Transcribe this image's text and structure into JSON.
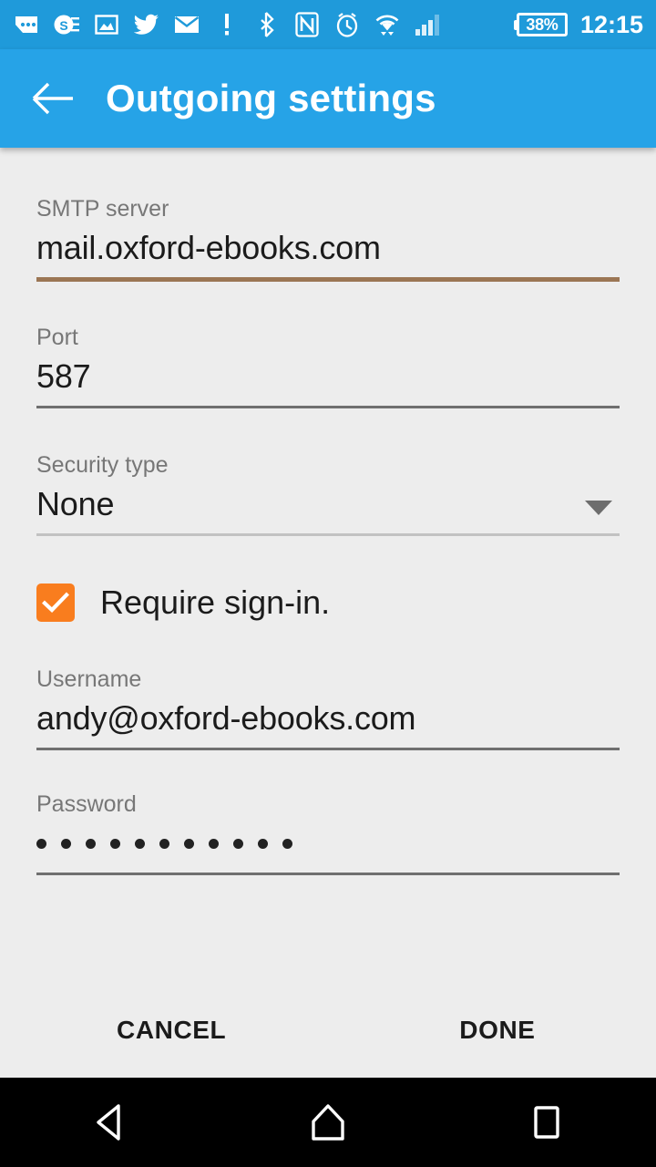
{
  "status_bar": {
    "background": "#1f9ada",
    "icons": [
      {
        "name": "messages-icon",
        "label": "messages"
      },
      {
        "name": "sway-document-icon",
        "label": "sway"
      },
      {
        "name": "photo-icon",
        "label": "photo"
      },
      {
        "name": "twitter-icon",
        "label": "twitter"
      },
      {
        "name": "email-icon",
        "label": "email"
      },
      {
        "name": "alert-exclamation-icon",
        "label": "alert"
      },
      {
        "name": "bluetooth-icon",
        "label": "bluetooth"
      },
      {
        "name": "nfc-icon",
        "label": "nfc"
      },
      {
        "name": "alarm-clock-icon",
        "label": "alarm"
      },
      {
        "name": "wifi-icon",
        "label": "wifi"
      },
      {
        "name": "cellular-signal-icon",
        "label": "signal"
      }
    ],
    "battery_level": "38%",
    "clock": "12:15"
  },
  "app_bar": {
    "background": "#26a3e7",
    "title": "Outgoing settings",
    "back_icon": "back-arrow-icon"
  },
  "form": {
    "smtp_server": {
      "label": "SMTP server",
      "value": "mail.oxford-ebooks.com",
      "underline_color": "#9b7654",
      "focused": true
    },
    "port": {
      "label": "Port",
      "value": "587",
      "underline_color": "#6f6f6f"
    },
    "security_type": {
      "label": "Security type",
      "value": "None",
      "underline_color": "#c2c2c2",
      "caret_icon": "chevron-down-icon"
    },
    "require_sign_in": {
      "label": "Require sign-in.",
      "checked": true,
      "checkbox_color": "#f97d1e"
    },
    "username": {
      "label": "Username",
      "value": "andy@oxford-ebooks.com",
      "underline_color": "#6f6f6f"
    },
    "password": {
      "label": "Password",
      "masked_value": "•••••••••••",
      "dot_count": 11,
      "underline_color": "#6f6f6f"
    }
  },
  "buttons": {
    "cancel": "CANCEL",
    "done": "DONE"
  },
  "nav_bar": {
    "background": "#000000",
    "back": "nav-back-icon",
    "home": "nav-home-icon",
    "recents": "nav-recents-icon"
  }
}
